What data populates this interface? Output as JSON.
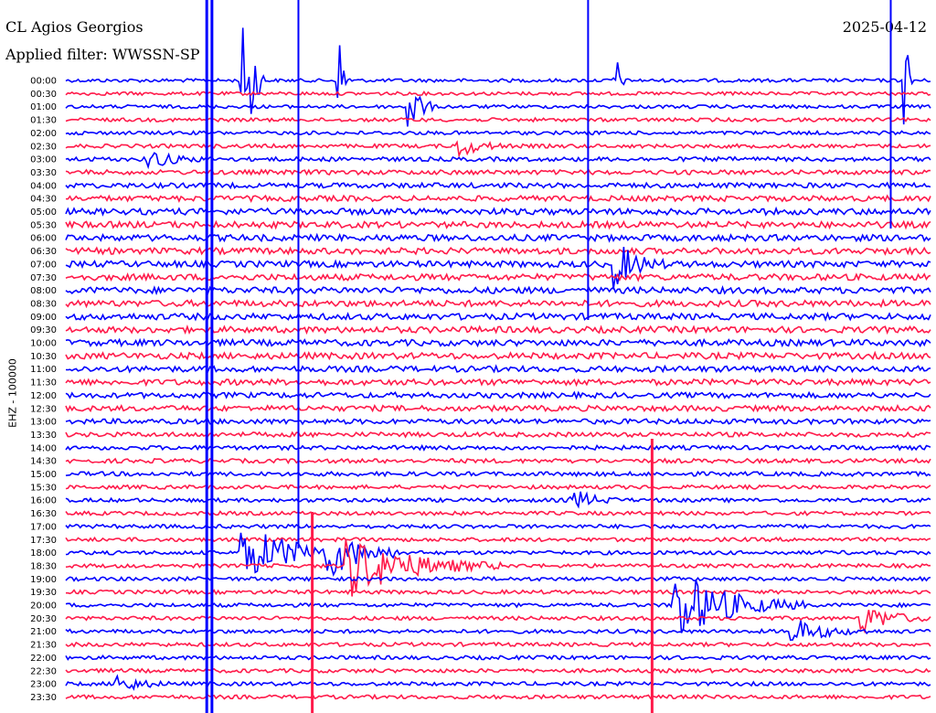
{
  "header": {
    "station": "CL Agios Georgios",
    "filter": "Applied filter: WWSSN-SP",
    "date": "2025-04-12"
  },
  "colors": {
    "trace_a": "#0000ff",
    "trace_b": "#ff1a4a",
    "background": "#ffffff"
  },
  "chart_data": {
    "type": "line",
    "title": "CL Agios Georgios",
    "subtitle": "Applied filter: WWSSN-SP",
    "date": "2025-04-12",
    "ylabel": "EHZ - 100000",
    "xlabel": "",
    "grid": false,
    "rows": [
      "00:00",
      "00:30",
      "01:00",
      "01:30",
      "02:00",
      "02:30",
      "03:00",
      "03:30",
      "04:00",
      "04:30",
      "05:00",
      "05:30",
      "06:00",
      "06:30",
      "07:00",
      "07:30",
      "08:00",
      "08:30",
      "09:00",
      "09:30",
      "10:00",
      "10:30",
      "11:00",
      "11:30",
      "12:00",
      "12:30",
      "13:00",
      "13:30",
      "14:00",
      "14:30",
      "15:00",
      "15:30",
      "16:00",
      "16:30",
      "17:00",
      "17:30",
      "18:00",
      "18:30",
      "19:00",
      "19:30",
      "20:00",
      "20:30",
      "21:00",
      "21:30",
      "22:00",
      "22:30",
      "23:00",
      "23:30"
    ],
    "noise_level": [
      0.3,
      0.3,
      0.3,
      0.35,
      0.35,
      0.4,
      0.5,
      0.6,
      0.7,
      0.8,
      1.0,
      1.0,
      1.0,
      1.0,
      1.0,
      1.0,
      1.0,
      1.0,
      1.0,
      1.0,
      1.0,
      1.0,
      0.9,
      0.9,
      0.8,
      0.8,
      0.7,
      0.6,
      0.5,
      0.5,
      0.5,
      0.4,
      0.4,
      0.4,
      0.4,
      0.4,
      0.4,
      0.4,
      0.4,
      0.4,
      0.4,
      0.4,
      0.4,
      0.4,
      0.4,
      0.4,
      0.4,
      0.4
    ],
    "events": [
      {
        "row": 0,
        "x": 0.205,
        "amp": 8.0,
        "dur": 0.006
      },
      {
        "row": 0,
        "x": 0.215,
        "amp": 8.0,
        "dur": 0.006
      },
      {
        "row": 0,
        "x": 0.317,
        "amp": 7.0,
        "dur": 0.004
      },
      {
        "row": 0,
        "x": 0.634,
        "amp": 8.0,
        "dur": 0.004
      },
      {
        "row": 0,
        "x": 0.972,
        "amp": 7.0,
        "dur": 0.004
      },
      {
        "row": 2,
        "x": 0.398,
        "amp": 5.0,
        "dur": 0.01
      },
      {
        "row": 5,
        "x": 0.455,
        "amp": 1.6,
        "dur": 0.02
      },
      {
        "row": 6,
        "x": 0.098,
        "amp": 1.5,
        "dur": 0.02
      },
      {
        "row": 14,
        "x": 0.634,
        "amp": 4.0,
        "dur": 0.02
      },
      {
        "row": 36,
        "x": 0.205,
        "amp": 4.0,
        "dur": 0.06
      },
      {
        "row": 36,
        "x": 0.305,
        "amp": 3.0,
        "dur": 0.03
      },
      {
        "row": 32,
        "x": 0.585,
        "amp": 1.8,
        "dur": 0.02
      },
      {
        "row": 37,
        "x": 0.325,
        "amp": 5.0,
        "dur": 0.06
      },
      {
        "row": 40,
        "x": 0.705,
        "amp": 6.0,
        "dur": 0.05
      },
      {
        "row": 42,
        "x": 0.84,
        "amp": 2.0,
        "dur": 0.03
      },
      {
        "row": 41,
        "x": 0.92,
        "amp": 2.2,
        "dur": 0.03
      },
      {
        "row": 46,
        "x": 0.06,
        "amp": 1.5,
        "dur": 0.02
      }
    ]
  }
}
